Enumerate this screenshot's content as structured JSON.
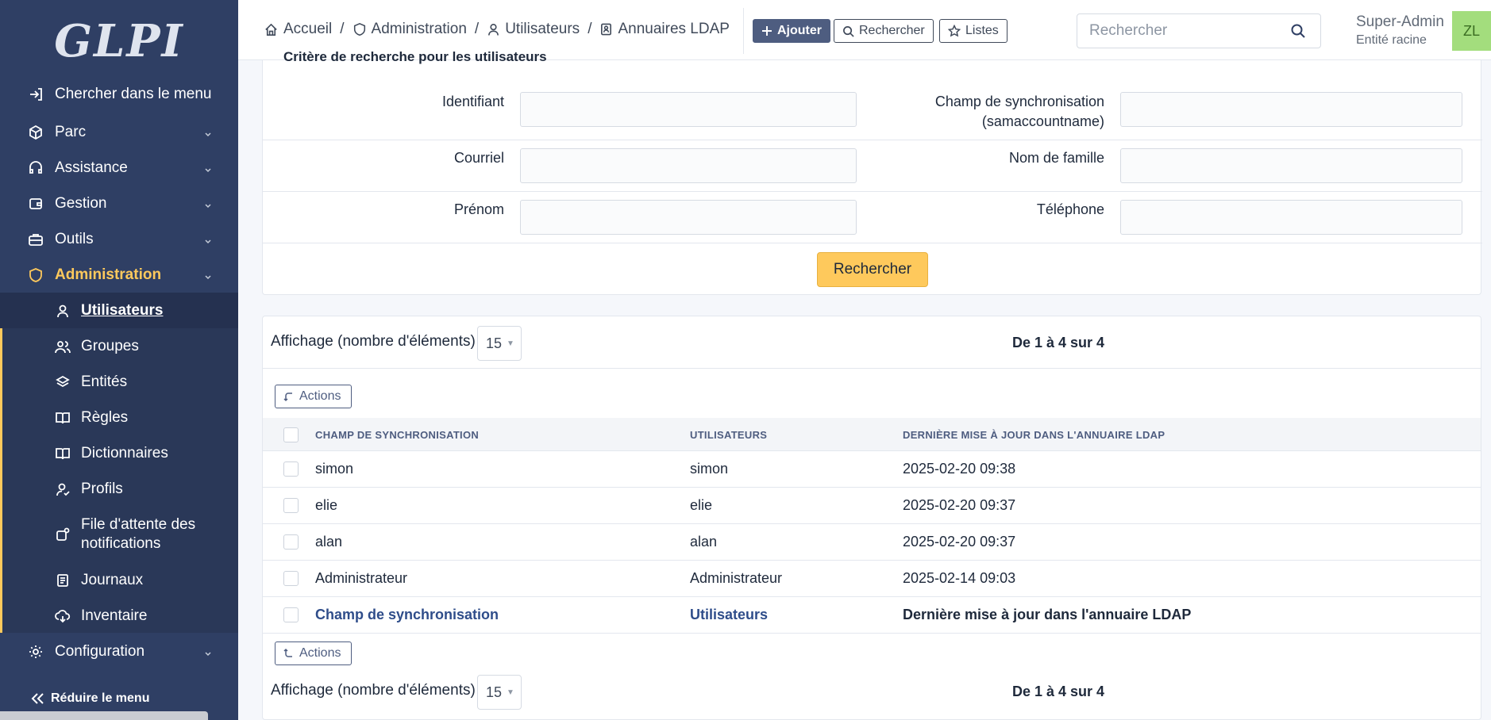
{
  "sidebar": {
    "logo": "GLPI",
    "search_menu": "Chercher dans le menu",
    "items": [
      {
        "label": "Parc"
      },
      {
        "label": "Assistance"
      },
      {
        "label": "Gestion"
      },
      {
        "label": "Outils"
      },
      {
        "label": "Administration"
      }
    ],
    "sub_items": [
      {
        "label": "Utilisateurs"
      },
      {
        "label": "Groupes"
      },
      {
        "label": "Entités"
      },
      {
        "label": "Règles"
      },
      {
        "label": "Dictionnaires"
      },
      {
        "label": "Profils"
      },
      {
        "label": "File d'attente des notifications"
      },
      {
        "label": "Journaux"
      },
      {
        "label": "Inventaire"
      }
    ],
    "configuration": "Configuration",
    "collapse": "Réduire le menu",
    "accent_color": "#fec95c"
  },
  "header": {
    "breadcrumb": [
      "Accueil",
      "Administration",
      "Utilisateurs",
      "Annuaires LDAP"
    ],
    "buttons": {
      "add": "Ajouter",
      "search": "Rechercher",
      "lists": "Listes"
    },
    "search_placeholder": "Rechercher",
    "user_name": "Super-Admin",
    "user_entity": "Entité racine",
    "avatar_initials": "ZL"
  },
  "criteria": {
    "title": "Critère de recherche pour les utilisateurs",
    "fields": {
      "identifiant": "Identifiant",
      "sync_field": "Champ de synchronisation (samaccountname)",
      "courriel": "Courriel",
      "nom_famille": "Nom de famille",
      "prenom": "Prénom",
      "telephone": "Téléphone"
    },
    "submit": "Rechercher"
  },
  "results": {
    "display_label": "Affichage (nombre d'éléments)",
    "per_page": "15",
    "pager": "De 1 à 4 sur 4",
    "actions_label": "Actions",
    "columns": [
      "Champ de synchronisation",
      "Utilisateurs",
      "Dernière mise à jour dans l'annuaire LDAP"
    ],
    "rows": [
      {
        "sync": "simon",
        "user": "simon",
        "updated": "2025-02-20 09:38"
      },
      {
        "sync": "elie",
        "user": "elie",
        "updated": "2025-02-20 09:37"
      },
      {
        "sync": "alan",
        "user": "alan",
        "updated": "2025-02-20 09:37"
      },
      {
        "sync": "Administrateur",
        "user": "Administrateur",
        "updated": "2025-02-14 09:03"
      }
    ],
    "footer": [
      "Champ de synchronisation",
      "Utilisateurs",
      "Dernière mise à jour dans l'annuaire LDAP"
    ]
  }
}
